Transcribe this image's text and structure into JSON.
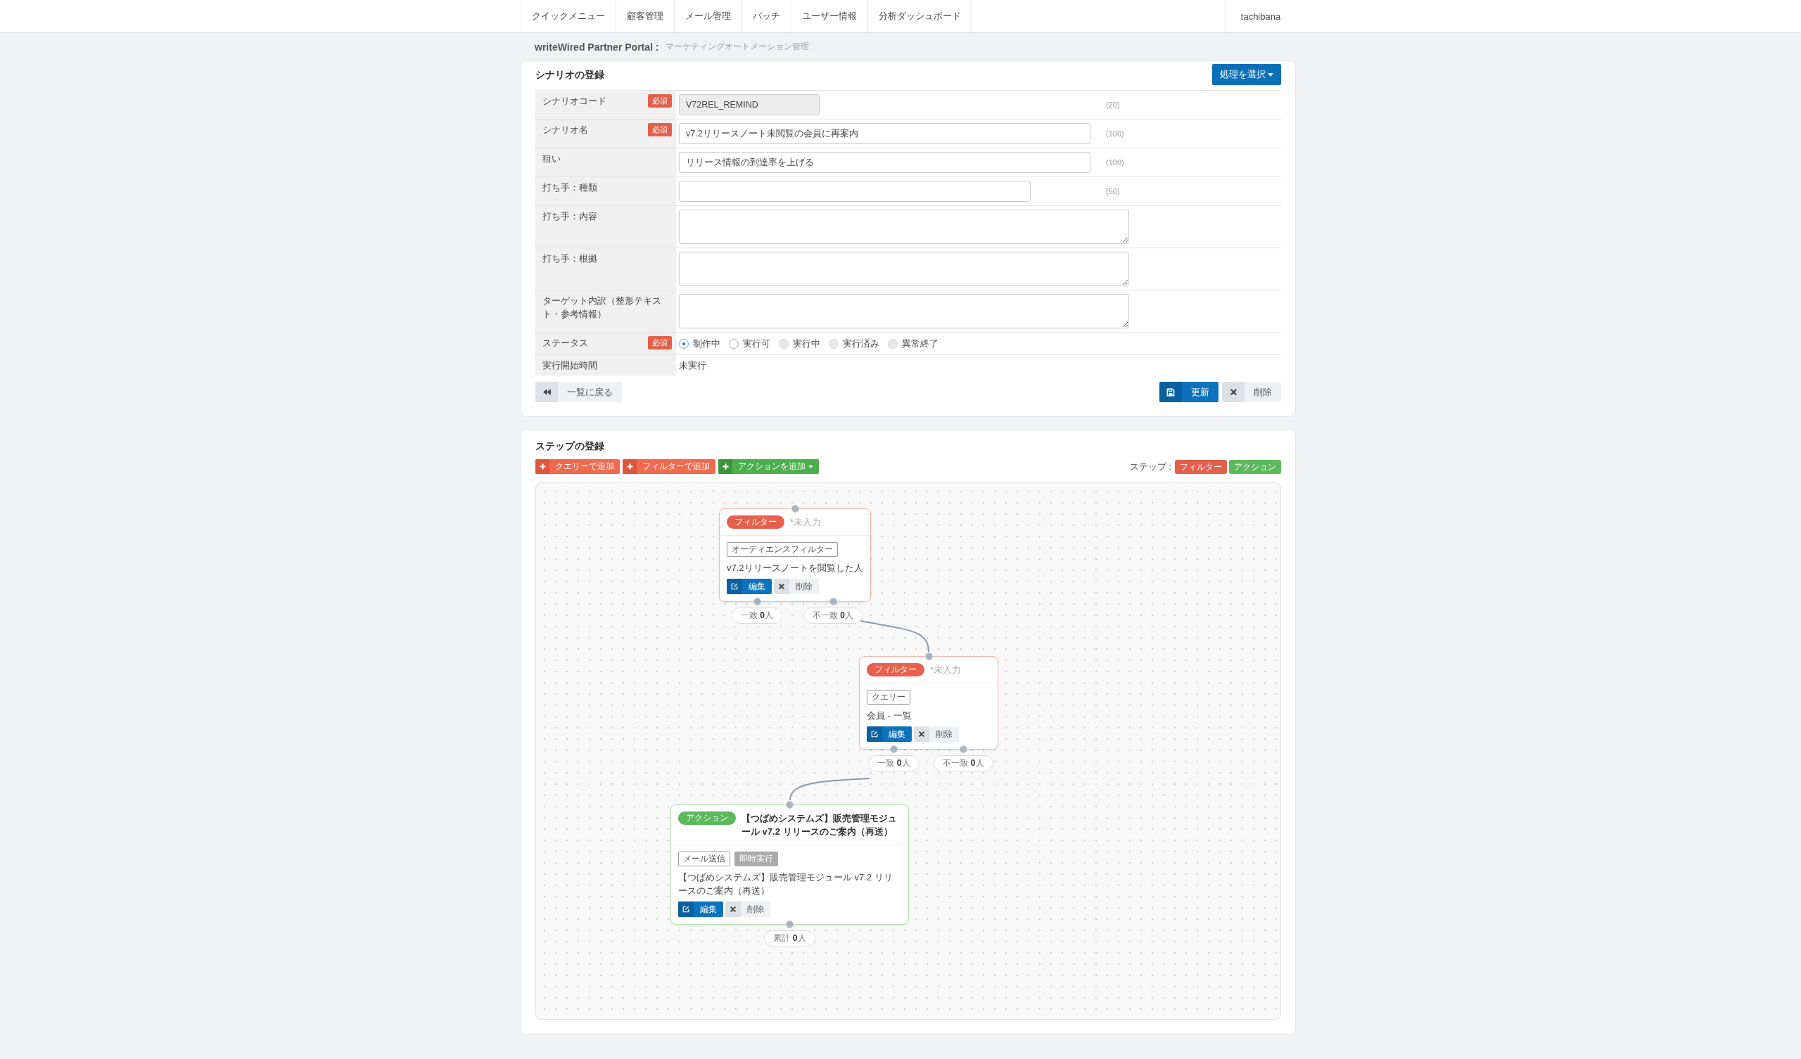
{
  "nav": {
    "items": [
      {
        "label": "クイックメニュー"
      },
      {
        "label": "顧客管理"
      },
      {
        "label": "メール管理"
      },
      {
        "label": "バッチ"
      },
      {
        "label": "ユーザー情報"
      },
      {
        "label": "分析ダッシュボード"
      }
    ],
    "user": "tachibana"
  },
  "breadcrumb": {
    "site": "writeWired Partner Portal :",
    "page": "マーケティングオートメーション管理"
  },
  "scenario_form": {
    "title": "シナリオの登録",
    "menu_button": "処理を選択",
    "fields": [
      {
        "kind": "text",
        "label": "シナリオコード",
        "badge": "必須",
        "value": "V72REL_REMIND",
        "readonly": true,
        "limit": "(20)"
      },
      {
        "kind": "text",
        "label": "シナリオ名",
        "badge": "必須",
        "value": "v7.2リリースノート未閲覧の会員に再案内",
        "readonly": false,
        "limit": "(100)"
      },
      {
        "kind": "text",
        "label": "狙い",
        "value": "リリース情報の到達率を上げる",
        "readonly": false,
        "limit": "(100)"
      },
      {
        "kind": "text",
        "label": "打ち手：種類",
        "readonly": false,
        "limit": "(50)"
      },
      {
        "kind": "textarea",
        "label": "打ち手：内容"
      },
      {
        "kind": "textarea",
        "label": "打ち手：根拠"
      },
      {
        "kind": "textarea",
        "label": "ターゲット内訳（整形テキスト・参考情報）"
      },
      {
        "kind": "radio",
        "label": "ステータス",
        "badge": "必須",
        "options": [
          {
            "label": "制作中",
            "selected": true,
            "disabled": false
          },
          {
            "label": "実行可",
            "selected": false,
            "disabled": false
          },
          {
            "label": "実行中",
            "selected": false,
            "disabled": true
          },
          {
            "label": "実行済み",
            "selected": false,
            "disabled": true
          },
          {
            "label": "異常終了",
            "selected": false,
            "disabled": true
          }
        ]
      },
      {
        "kind": "plain",
        "label": "実行開始時間",
        "value": "未実行"
      }
    ],
    "back_button": "一覧に戻る",
    "update_button": "更新",
    "delete_button": "削除"
  },
  "step_editor": {
    "title": "ステップの登録",
    "add_buttons": [
      {
        "label": "クエリーで追加",
        "kind": "filter",
        "dropdown": false
      },
      {
        "label": "フィルターで追加",
        "kind": "filter",
        "dropdown": false
      },
      {
        "label": "アクションを追加",
        "kind": "action",
        "dropdown": true
      }
    ],
    "legend_label": "ステップ :",
    "legend": [
      {
        "label": "フィルター",
        "kind": "filter"
      },
      {
        "label": "アクション",
        "kind": "action"
      }
    ],
    "nodes": [
      {
        "kind": "filter",
        "badge": "フィルター",
        "title_placeholder": "*未入力",
        "tags": [
          {
            "label": "オーディエンスフィルター",
            "kind": "outline"
          }
        ],
        "description": "v7.2リリースノートを閲覧した人",
        "edit": "編集",
        "delete": "削除",
        "outputs": [
          "一致 **0**人",
          "不一致 **0**人"
        ]
      },
      {
        "kind": "filter",
        "badge": "フィルター",
        "title_placeholder": "*未入力",
        "tags": [
          {
            "label": "クエリー",
            "kind": "outline"
          }
        ],
        "description": "会員 - 一覧",
        "edit": "編集",
        "delete": "削除",
        "outputs": [
          "一致 **0**人",
          "不一致 **0**人"
        ]
      },
      {
        "kind": "action",
        "badge": "アクション",
        "title": "【つばめシステムズ】販売管理モジュール v7.2 リリースのご案内（再送）",
        "tags": [
          {
            "label": "メール送信",
            "kind": "outline"
          },
          {
            "label": "即時実行",
            "kind": "muted"
          }
        ],
        "description": "【つばめシステムズ】販売管理モジュール v7.2 リリースのご案内（再送）",
        "edit": "編集",
        "delete": "削除",
        "outputs": [
          "累計 **0**人"
        ]
      }
    ]
  }
}
